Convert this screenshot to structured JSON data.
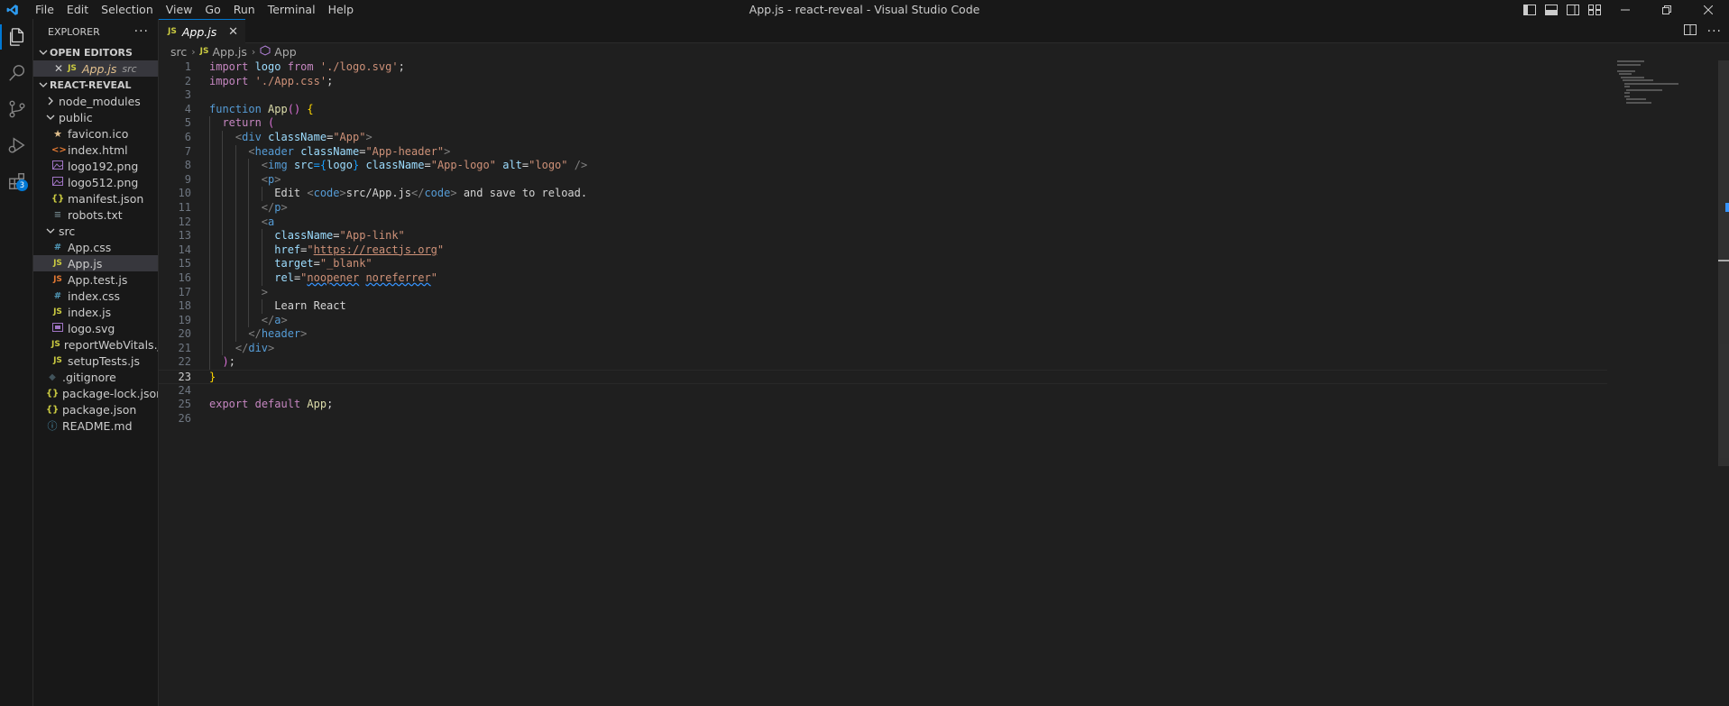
{
  "window": {
    "title": "App.js - react-reveal - Visual Studio Code",
    "menu": [
      "File",
      "Edit",
      "Selection",
      "View",
      "Go",
      "Run",
      "Terminal",
      "Help"
    ]
  },
  "activity_bar": {
    "items": [
      "explorer-icon",
      "search-icon",
      "source-control-icon",
      "run-debug-icon",
      "extensions-icon"
    ],
    "extensions_badge": "3"
  },
  "sidebar": {
    "header": "EXPLORER",
    "open_editors_title": "OPEN EDITORS",
    "open_editor": {
      "name": "App.js",
      "desc": "src"
    },
    "project_title": "REACT-REVEAL",
    "tree": {
      "node_modules": "node_modules",
      "public": "public",
      "public_files": [
        "favicon.ico",
        "index.html",
        "logo192.png",
        "logo512.png",
        "manifest.json",
        "robots.txt"
      ],
      "src": "src",
      "src_files": [
        "App.css",
        "App.js",
        "App.test.js",
        "index.css",
        "index.js",
        "logo.svg",
        "reportWebVitals.js",
        "setupTests.js"
      ],
      "root_files": [
        ".gitignore",
        "package-lock.json",
        "package.json",
        "README.md"
      ]
    }
  },
  "editor": {
    "tab": {
      "icon": "JS",
      "label": "App.js"
    },
    "breadcrumb": {
      "folder": "src",
      "file": "App.js",
      "symbol": "App"
    },
    "colors": {
      "accent": "#0078d4",
      "keyword": "#c586c0",
      "string": "#ce9178",
      "function": "#dcdcaa",
      "variable": "#9cdcfe"
    },
    "code": {
      "l1_a": "import",
      "l1_b": " logo ",
      "l1_c": "from",
      "l1_d": "'./logo.svg'",
      "l1_e": ";",
      "l2_a": "import",
      "l2_b": "'./App.css'",
      "l2_c": ";",
      "l4_a": "function",
      "l4_b": "App",
      "l4_c": "()",
      "l4_d": "{",
      "l5_a": "return",
      "l5_b": "(",
      "l6_a": "<",
      "l6_b": "div",
      "l6_c": "className",
      "l6_d": "=",
      "l6_e": "\"App\"",
      "l6_f": ">",
      "l7_a": "<",
      "l7_b": "header",
      "l7_c": "className",
      "l7_d": "=",
      "l7_e": "\"App-header\"",
      "l7_f": ">",
      "l8_a": "<",
      "l8_b": "img",
      "l8_c": "src",
      "l8_d": "={",
      "l8_e": "logo",
      "l8_f": "}",
      "l8_g": "className",
      "l8_h": "=",
      "l8_i": "\"App-logo\"",
      "l8_j": "alt",
      "l8_k": "=",
      "l8_l": "\"logo\"",
      "l8_m": "/>",
      "l9_a": "<",
      "l9_b": "p",
      "l9_c": ">",
      "l10_a": "Edit ",
      "l10_b": "<",
      "l10_c": "code",
      "l10_d": ">",
      "l10_e": "src/App.js",
      "l10_f": "</",
      "l10_g": "code",
      "l10_h": ">",
      "l10_i": " and save to reload.",
      "l11_a": "</",
      "l11_b": "p",
      "l11_c": ">",
      "l12_a": "<",
      "l12_b": "a",
      "l13_a": "className",
      "l13_b": "=",
      "l13_c": "\"App-link\"",
      "l14_a": "href",
      "l14_b": "=",
      "l14_c": "\"",
      "l14_d": "https://reactjs.org",
      "l14_e": "\"",
      "l15_a": "target",
      "l15_b": "=",
      "l15_c": "\"_blank\"",
      "l16_a": "rel",
      "l16_b": "=",
      "l16_c": "\"",
      "l16_d": "noopener",
      "l16_e": " ",
      "l16_f": "noreferrer",
      "l16_g": "\"",
      "l17_a": ">",
      "l18_a": "Learn React",
      "l19_a": "</",
      "l19_b": "a",
      "l19_c": ">",
      "l20_a": "</",
      "l20_b": "header",
      "l20_c": ">",
      "l21_a": "</",
      "l21_b": "div",
      "l21_c": ">",
      "l22_a": ")",
      "l22_b": ";",
      "l23_a": "}",
      "l25_a": "export",
      "l25_b": "default",
      "l25_c": "App",
      "l25_d": ";"
    },
    "line_numbers": [
      "1",
      "2",
      "3",
      "4",
      "5",
      "6",
      "7",
      "8",
      "9",
      "10",
      "11",
      "12",
      "13",
      "14",
      "15",
      "16",
      "17",
      "18",
      "19",
      "20",
      "21",
      "22",
      "23",
      "24",
      "25",
      "26"
    ]
  }
}
